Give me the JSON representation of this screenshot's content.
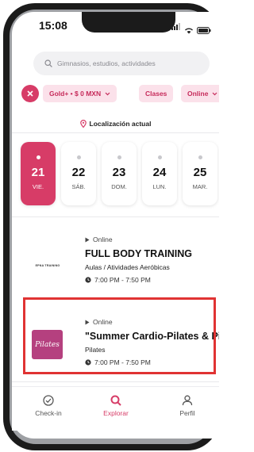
{
  "status_bar": {
    "time": "15:08"
  },
  "search": {
    "placeholder": "Gimnasios, estudios, actividades"
  },
  "filters": {
    "plan_chip": "Gold+ • $ 0 MXN",
    "classes_chip": "Clases",
    "online_chip": "Online"
  },
  "location": {
    "label": "Localización actual"
  },
  "days": [
    {
      "num": "21",
      "dow": "VIE.",
      "selected": true
    },
    {
      "num": "22",
      "dow": "SÁB.",
      "selected": false
    },
    {
      "num": "23",
      "dow": "DOM.",
      "selected": false
    },
    {
      "num": "24",
      "dow": "LUN.",
      "selected": false
    },
    {
      "num": "25",
      "dow": "MAR.",
      "selected": false
    }
  ],
  "classes": [
    {
      "logo_text": "EPNA TRAINING",
      "mode": "Online",
      "title": "FULL BODY TRAINING",
      "category": "Aulas / Atividades Aeróbicas",
      "time": "7:00 PM - 7:50 PM"
    },
    {
      "logo_text": "Pilates",
      "mode": "Online",
      "title": "\"Summer Cardio-Pilates & Pil...",
      "category": "Pilates",
      "time": "7:00 PM - 7:50 PM"
    }
  ],
  "tabs": {
    "checkin": "Check-in",
    "explore": "Explorar",
    "profile": "Perfil"
  },
  "colors": {
    "accent": "#d73c67",
    "chip_bg": "#fbe1ea",
    "highlight": "#e03333"
  }
}
